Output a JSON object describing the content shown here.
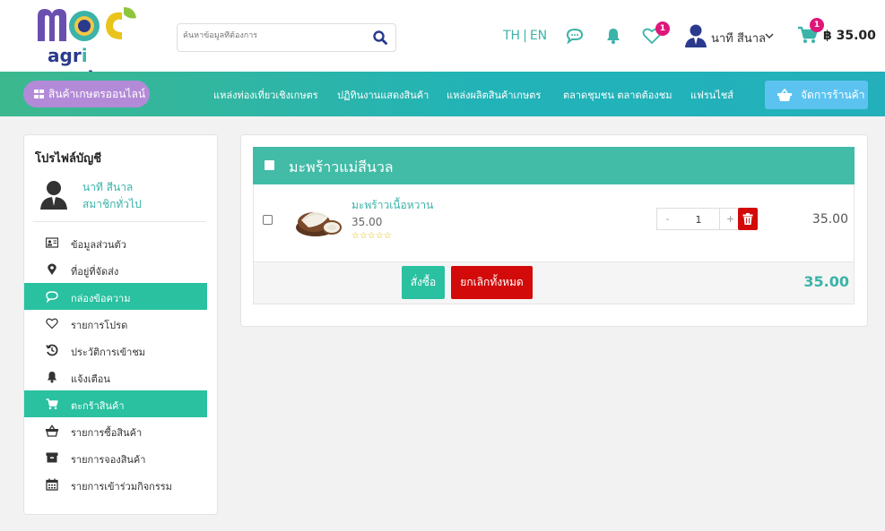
{
  "header": {
    "logo_text_a": "agr",
    "logo_text_i": "i",
    "logo_text_b": " mart",
    "search_placeholder": "ค้นหาข้อมูลที่ต้องการ",
    "lang_th": "TH",
    "lang_sep": "|",
    "lang_en": "EN",
    "wishlist_count": "1",
    "user_name": "นาที สีนาล",
    "cart_count": "1",
    "cart_total": "฿ 35.00"
  },
  "nav": {
    "category_button": "สินค้าเกษตรออนไลน์",
    "items": [
      "แหล่งท่องเที่ยวเชิงเกษตร",
      "ปฏิทินงานแสดงสินค้า",
      "แหล่งผลิตสินค้าเกษตร",
      "ตลาดชุมชน ตลาดต้องชม",
      "แฟรนไชส์"
    ],
    "shop_button": "จัดการร้านค้า"
  },
  "sidebar": {
    "title": "โปรไฟล์บัญชี",
    "username": "นาที สีนาล",
    "role": "สมาชิกทั่วไป",
    "items": [
      {
        "label": "ข้อมูลส่วนตัว",
        "icon": "id-card-icon"
      },
      {
        "label": "ที่อยู่ที่จัดส่ง",
        "icon": "map-marker-icon"
      },
      {
        "label": "กล่องข้อความ",
        "icon": "chat-icon"
      },
      {
        "label": "รายการโปรด",
        "icon": "heart-icon"
      },
      {
        "label": "ประวัติการเข้าชม",
        "icon": "history-icon"
      },
      {
        "label": "แจ้งเตือน",
        "icon": "bell-icon"
      },
      {
        "label": "ตะกร้าสินค้า",
        "icon": "cart-icon"
      },
      {
        "label": "รายการซื้อสินค้า",
        "icon": "basket-icon"
      },
      {
        "label": "รายการจองสินค้า",
        "icon": "archive-icon"
      },
      {
        "label": "รายการเข้าร่วมกิจกรรม",
        "icon": "calendar-icon"
      }
    ]
  },
  "cart": {
    "shop_name": "มะพร้าวแม่สีนวล",
    "item": {
      "name": "มะพร้าวเนื้อหวาน",
      "price": "35.00",
      "stars": "☆☆☆☆☆",
      "rating": 0,
      "qty_minus": "-",
      "qty": "1",
      "qty_plus": "+",
      "total": "35.00"
    },
    "order_button": "สั่งซื้อ",
    "cancel_button": "ยกเลิกทั้งหมด",
    "grand_total": "35.00"
  },
  "colors": {
    "brand_teal": "#3bb3a8",
    "nav_gradient_start": "#3db88e",
    "nav_gradient_end": "#23b0bb",
    "active_green": "#29c1a0",
    "danger_red": "#d30a0a",
    "badge_pink": "#e0157a",
    "category_purple": "#b38ad8",
    "shop_blue": "#5cc3f0"
  }
}
